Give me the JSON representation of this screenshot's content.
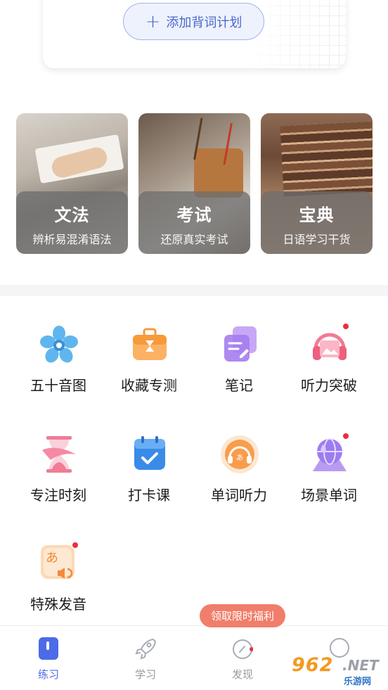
{
  "plan": {
    "add_label": "添加背词计划",
    "plus": "+"
  },
  "categories": [
    {
      "title": "文法",
      "subtitle": "辨析易混淆语法"
    },
    {
      "title": "考试",
      "subtitle": "还原真实考试"
    },
    {
      "title": "宝典",
      "subtitle": "日语学习干货"
    }
  ],
  "grid": [
    {
      "label": "五十音图",
      "icon": "sakura-icon",
      "dot": false
    },
    {
      "label": "收藏专测",
      "icon": "briefcase-hourglass-icon",
      "dot": false
    },
    {
      "label": "笔记",
      "icon": "notes-icon",
      "dot": false
    },
    {
      "label": "听力突破",
      "icon": "headphones-icon",
      "dot": true
    },
    {
      "label": "专注时刻",
      "icon": "hourglass-icon",
      "dot": false
    },
    {
      "label": "打卡课",
      "icon": "calendar-check-icon",
      "dot": false
    },
    {
      "label": "单词听力",
      "icon": "headset-kana-icon",
      "dot": false
    },
    {
      "label": "场景单词",
      "icon": "globe-icon",
      "dot": true
    },
    {
      "label": "特殊发音",
      "icon": "kana-speaker-icon",
      "dot": true
    }
  ],
  "promo": {
    "label": "领取限时福利"
  },
  "tabs": [
    {
      "label": "练习",
      "icon": "practice-icon",
      "active": true
    },
    {
      "label": "学习",
      "icon": "rocket-icon",
      "active": false
    },
    {
      "label": "发现",
      "icon": "compass-icon",
      "active": false
    },
    {
      "label": "",
      "icon": "profile-icon",
      "active": false
    }
  ],
  "watermark": {
    "number": "962",
    "domain": ".NET",
    "site": "乐游网"
  },
  "colors": {
    "accent": "#4d6ae8",
    "promo": "#f07e6b",
    "badge": "#e8303f"
  }
}
